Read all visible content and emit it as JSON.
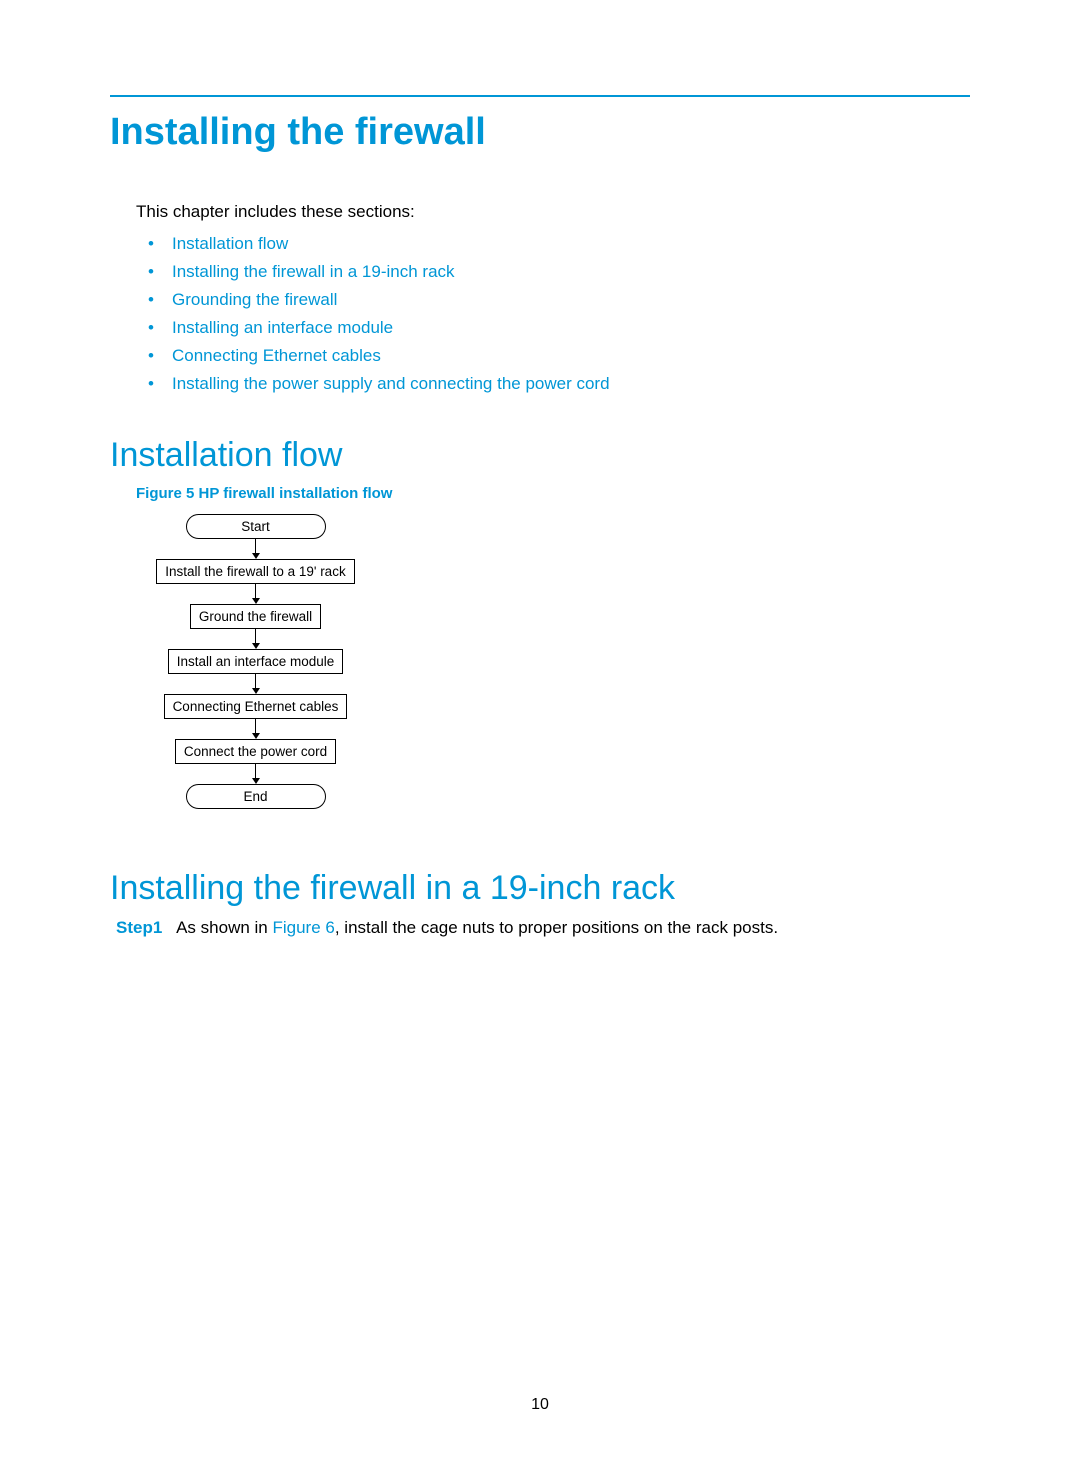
{
  "title": "Installing the firewall",
  "intro": "This chapter includes these sections:",
  "sections": [
    "Installation flow",
    "Installing the firewall in a 19-inch rack",
    "Grounding the firewall",
    "Installing an interface module",
    "Connecting Ethernet cables",
    "Installing the power supply and connecting the power cord"
  ],
  "heading_flow": "Installation flow",
  "figure_caption": "Figure 5 HP firewall installation flow",
  "flow": {
    "start": "Start",
    "steps": [
      "Install the firewall to a 19' rack",
      "Ground the firewall",
      "Install an interface module",
      "Connecting Ethernet cables",
      "Connect the power cord"
    ],
    "end": "End"
  },
  "heading_rack": "Installing the firewall in a 19-inch rack",
  "step1": {
    "label": "Step1",
    "pre": "As shown in ",
    "link": "Figure 6",
    "post": ", install the cage nuts to proper positions on the rack posts."
  },
  "page_number": "10"
}
